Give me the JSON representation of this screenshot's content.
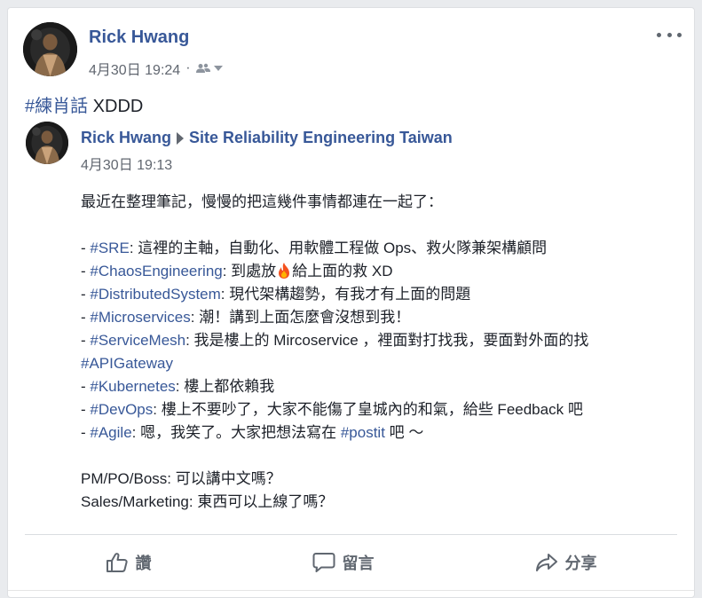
{
  "post": {
    "author": "Rick Hwang",
    "time": "4月30日 19:24",
    "separator": "·",
    "audience_icon": "friends-icon",
    "text_hashtag": "#練肖話",
    "text_rest": " XDDD"
  },
  "shared": {
    "author": "Rick Hwang",
    "group": "Site Reliability Engineering Taiwan",
    "time": "4月30日 19:13",
    "intro": "最近在整理筆記，慢慢的把這幾件事情都連在一起了：",
    "items": [
      {
        "prefix": "- ",
        "tag": "#SRE",
        "text": ": 這裡的主軸，自動化、用軟體工程做 Ops、救火隊兼架構顧問"
      },
      {
        "prefix": "- ",
        "tag": "#ChaosEngineering",
        "text": ": 到處放",
        "text2": "給上面的救 XD"
      },
      {
        "prefix": "- ",
        "tag": "#DistributedSystem",
        "text": ": 現代架構趨勢，有我才有上面的問題"
      },
      {
        "prefix": "- ",
        "tag": "#Microservices",
        "text": ": 潮！講到上面怎麼會沒想到我！"
      },
      {
        "prefix": "- ",
        "tag": "#ServiceMesh",
        "text": ": 我是樓上的 Mircoservice ，裡面對打找我，要面對外面的找"
      },
      {
        "prefix": "",
        "tag": "#APIGateway",
        "text": ""
      },
      {
        "prefix": "- ",
        "tag": "#Kubernetes",
        "text": ": 樓上都依賴我"
      },
      {
        "prefix": "- ",
        "tag": "#DevOps",
        "text": ": 樓上不要吵了，大家不能傷了皇城內的和氣，給些 Feedback 吧"
      },
      {
        "prefix": "- ",
        "tag": "#Agile",
        "text": ": 嗯，我笑了。大家把想法寫在 ",
        "tag2": "#postit",
        "text2": " 吧 ～"
      }
    ],
    "outro": [
      "PM/PO/Boss: 可以講中文嗎？",
      "Sales/Marketing: 東西可以上線了嗎？"
    ]
  },
  "actions": {
    "like": "讚",
    "comment": "留言",
    "share": "分享"
  },
  "colors": {
    "link": "#385898",
    "meta": "#616770",
    "text": "#1d2129",
    "background": "#e9ebee"
  }
}
